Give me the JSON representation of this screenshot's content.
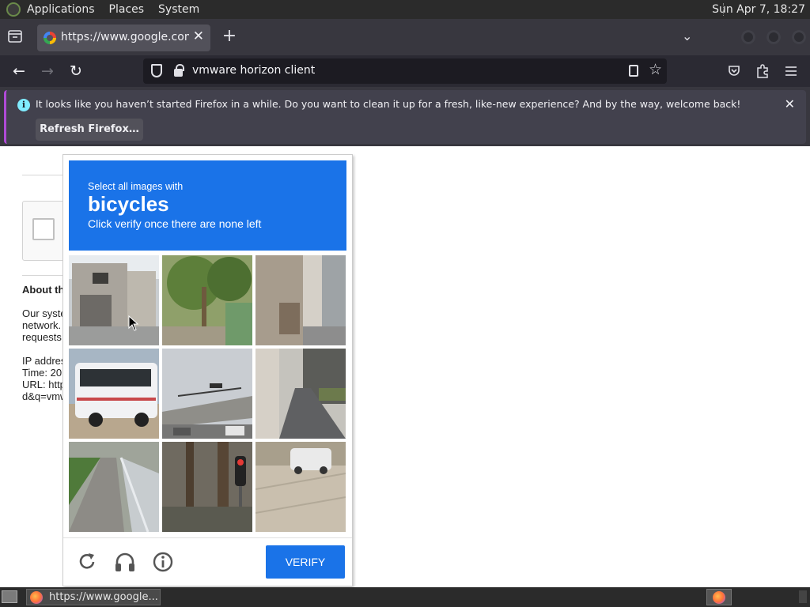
{
  "gnome_panel": {
    "menus": [
      "Applications",
      "Places",
      "System"
    ],
    "clock": "Sun Apr  7, 18:27"
  },
  "browser": {
    "tab": {
      "title": "https://www.google.com/sorry/index",
      "icon": "google-g-icon"
    },
    "url": "vmware horizon client",
    "notification": {
      "message": "It looks like you haven’t started Firefox in a while. Do you want to clean it up for a fresh, like-new experience? And by the way, welcome back!",
      "button": "Refresh Firefox…"
    }
  },
  "page": {
    "about_heading": "About th",
    "body_lines": [
      "Our syste",
      "network.",
      "requests"
    ],
    "info_lines": [
      "IP addres",
      "Time: 20",
      "URL: http",
      "d&q=vmw"
    ]
  },
  "captcha": {
    "prompt": "Select all images with",
    "target": "bicycles",
    "instruction": "Click verify once there are none left",
    "verify_label": "VERIFY",
    "header_color": "#1a73e8",
    "tiles": [
      {
        "label": "house with garage"
      },
      {
        "label": "tree by road"
      },
      {
        "label": "building alley"
      },
      {
        "label": "white bus"
      },
      {
        "label": "overpass with traffic light"
      },
      {
        "label": "narrow street"
      },
      {
        "label": "sidewalk with hedge"
      },
      {
        "label": "traffic light and trees"
      },
      {
        "label": "parked cars on pavement"
      }
    ]
  },
  "taskbar": {
    "task_title": "https://www.google..."
  }
}
